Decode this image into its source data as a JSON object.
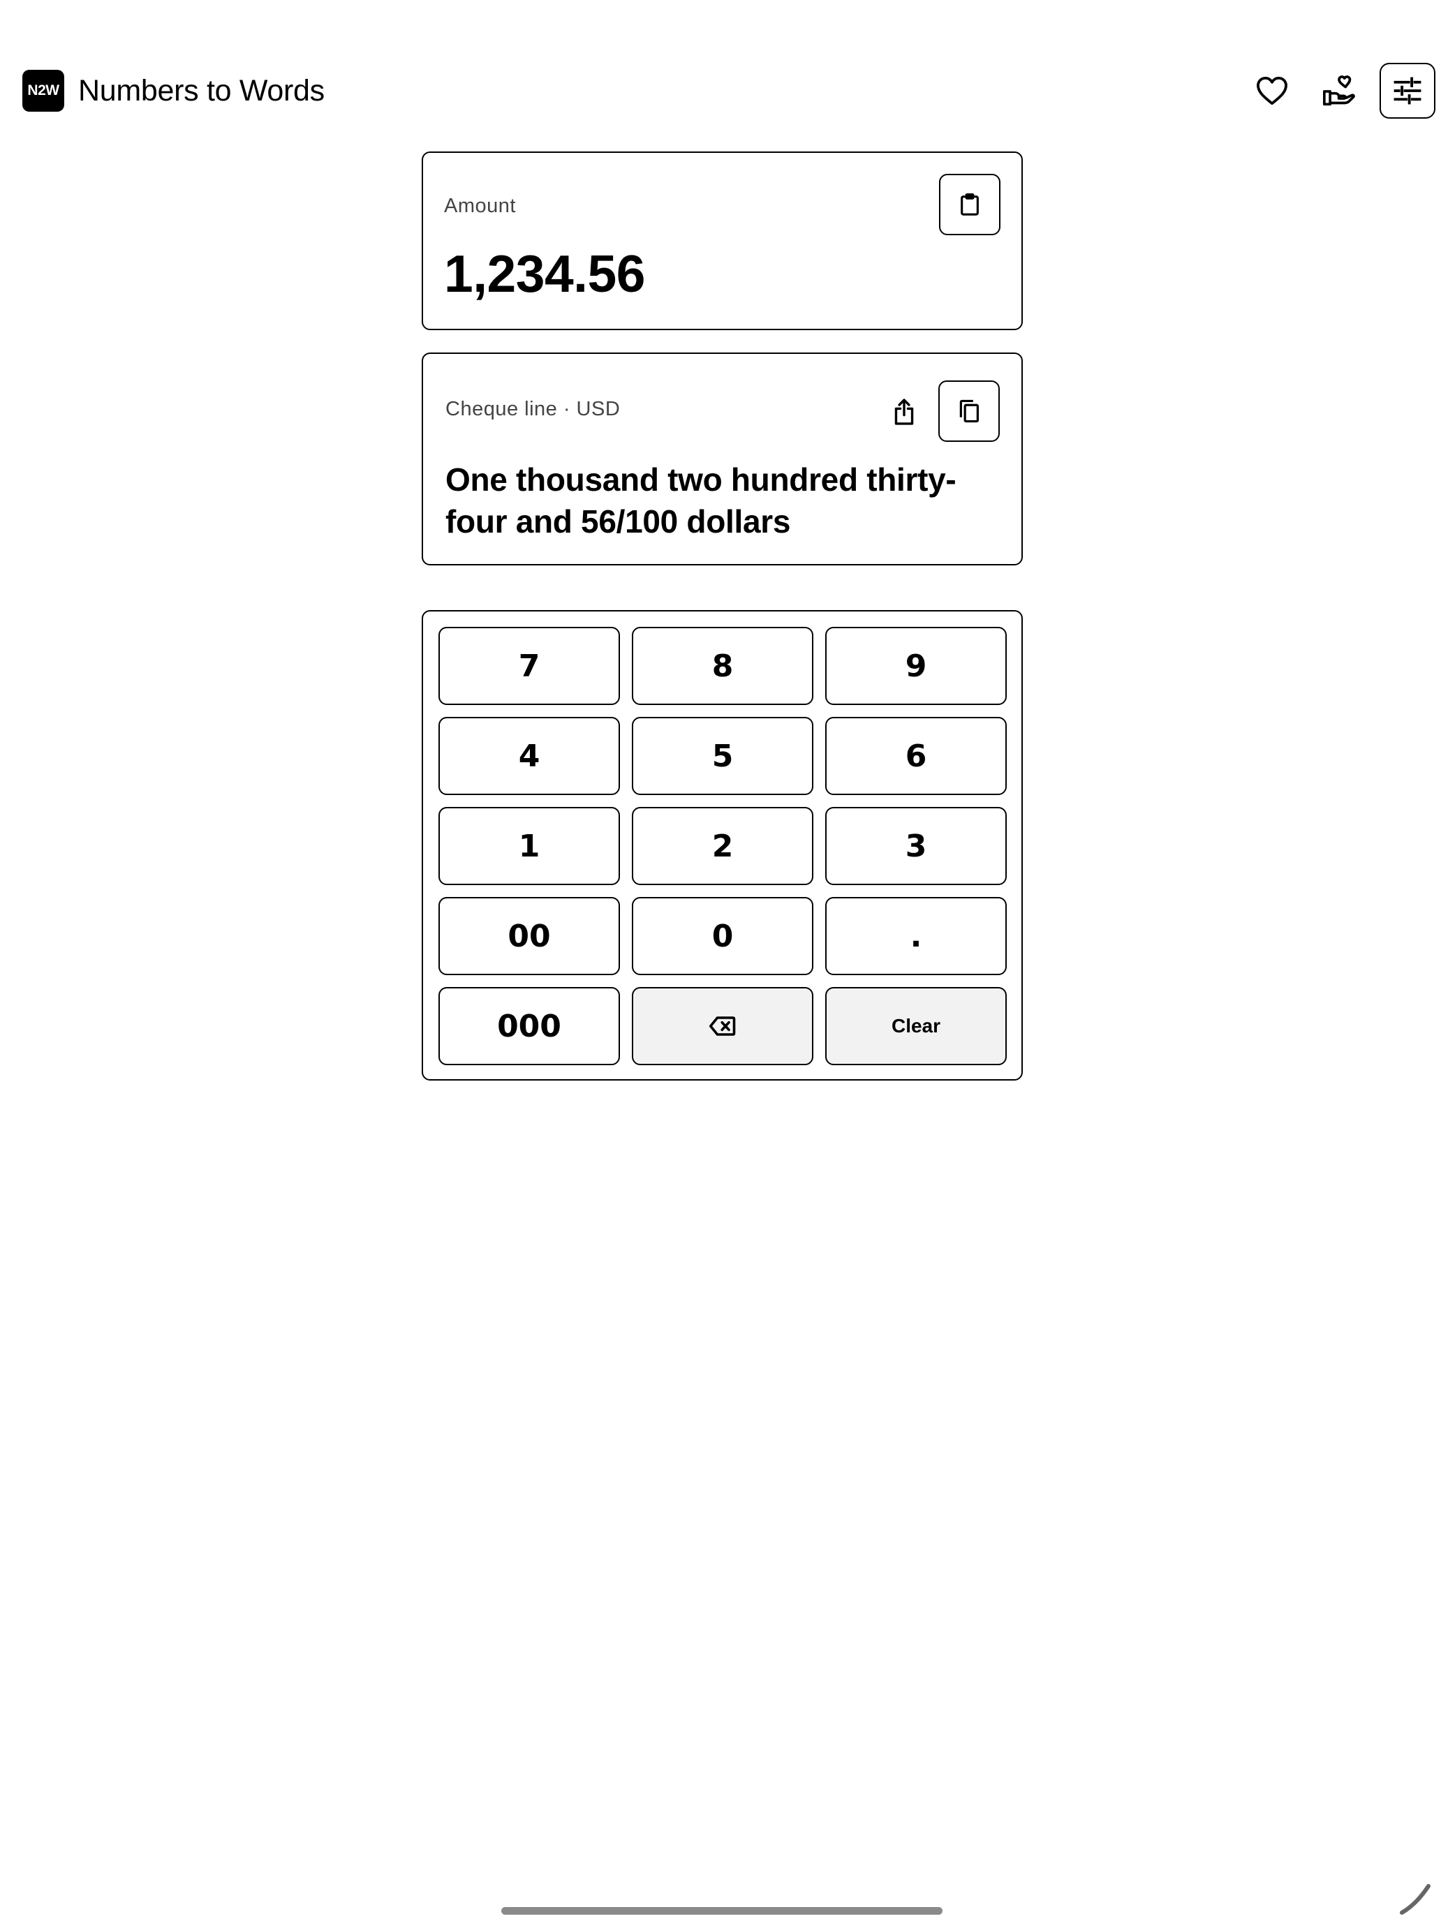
{
  "header": {
    "logo_text": "N2W",
    "title": "Numbers to Words",
    "icons": [
      "heart-icon",
      "donate-icon",
      "settings-sliders-icon"
    ]
  },
  "amount": {
    "label": "Amount",
    "value": "1,234.56",
    "paste_icon": "clipboard-icon"
  },
  "cheque": {
    "label": "Cheque line · USD",
    "text": "One thousand two hundred thirty-four and 56/100 dollars",
    "share_icon": "share-icon",
    "copy_icon": "copy-icon"
  },
  "keypad": {
    "keys": [
      "7",
      "8",
      "9",
      "4",
      "5",
      "6",
      "1",
      "2",
      "3",
      "00",
      "0",
      ".",
      "000"
    ],
    "clear_label": "Clear",
    "backspace_icon": "backspace-icon"
  },
  "colors": {
    "foreground": "#000000",
    "background": "#ffffff",
    "muted_key": "#f2f2f2",
    "label_text": "#444444"
  }
}
